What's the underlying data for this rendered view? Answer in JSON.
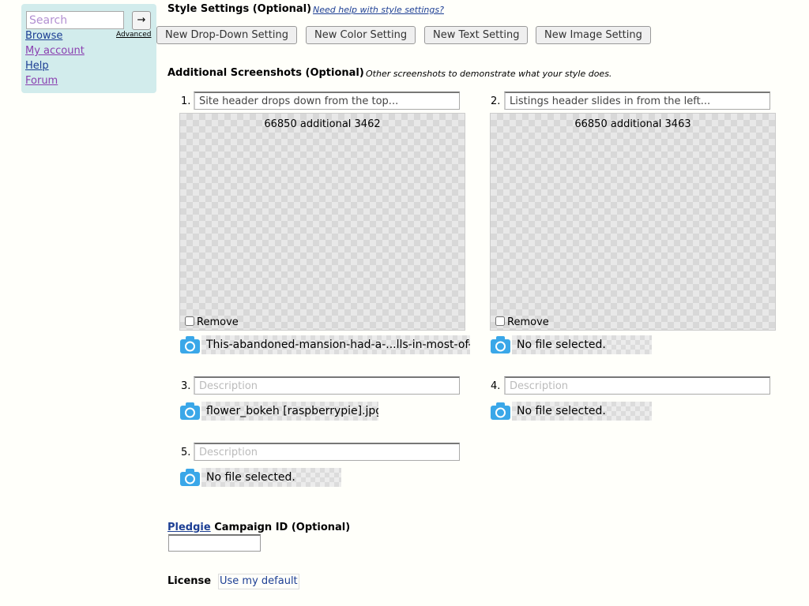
{
  "nav": {
    "search_placeholder": "Search",
    "search_button": "→",
    "advanced": "Advanced",
    "links": [
      "Browse",
      "My account",
      "Help",
      "Forum"
    ]
  },
  "style_settings": {
    "heading": "Style Settings (Optional)",
    "help_link": "Need help with style settings?",
    "buttons": [
      "New Drop-Down Setting",
      "New Color Setting",
      "New Text Setting",
      "New Image Setting"
    ]
  },
  "screenshots": {
    "heading": "Additional Screenshots (Optional)",
    "hint": "Other screenshots to demonstrate what your style does.",
    "description_placeholder": "Description",
    "remove_label": "Remove",
    "slots": [
      {
        "number": "1.",
        "description": "Site header drops down from the top...",
        "preview_caption": "66850 additional 3462",
        "file": "This-abandoned-mansion-had-a-...lls-in-most-of-th"
      },
      {
        "number": "2.",
        "description": "Listings header slides in from the left...",
        "preview_caption": "66850 additional 3463",
        "file": "No file selected."
      },
      {
        "number": "3.",
        "description": "",
        "file": "flower_bokeh [raspberrypie].jpg"
      },
      {
        "number": "4.",
        "description": "",
        "file": "No file selected."
      },
      {
        "number": "5.",
        "description": "",
        "file": "No file selected."
      }
    ]
  },
  "pledgie": {
    "link": "Pledgie",
    "label": " Campaign ID (Optional)",
    "value": ""
  },
  "license": {
    "label": "License",
    "selected": "Use my default"
  },
  "colors": {
    "nav_bg": "#d2ecec",
    "link": "#1d3f94",
    "visited_link": "#8a3fb0",
    "camera": "#3aa7e8"
  }
}
